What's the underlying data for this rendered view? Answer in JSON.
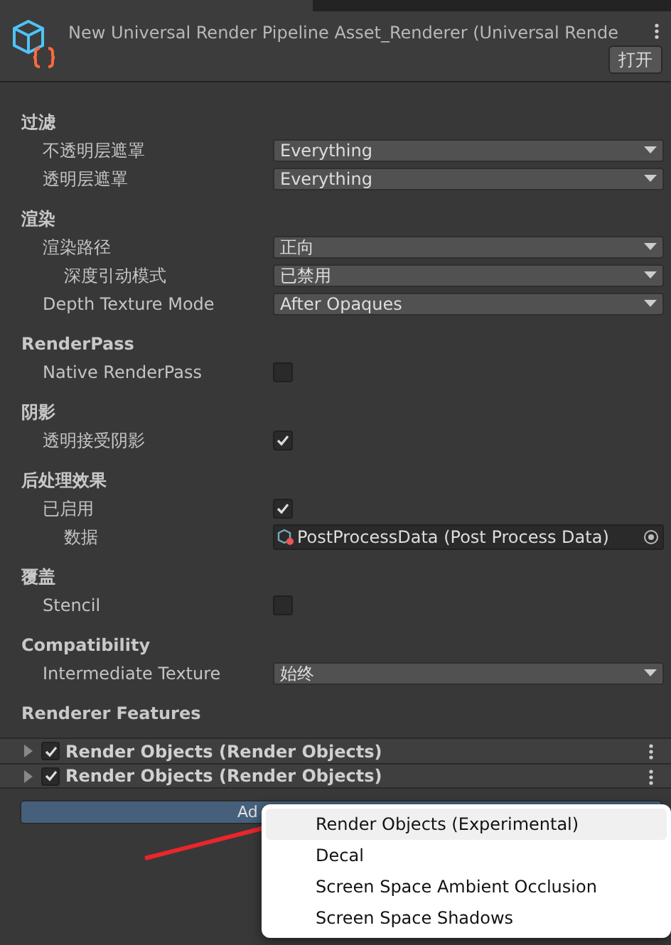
{
  "header": {
    "title": "New Universal Render Pipeline Asset_Renderer (Universal Rende",
    "open_button": "打开"
  },
  "sections": [
    {
      "title": "过滤",
      "rows": [
        {
          "label": "不透明层遮罩",
          "kind": "dropdown",
          "value": "Everything"
        },
        {
          "label": "透明层遮罩",
          "kind": "dropdown",
          "value": "Everything"
        }
      ]
    },
    {
      "title": "渲染",
      "rows": [
        {
          "label": "渲染路径",
          "kind": "dropdown",
          "value": "正向",
          "children": [
            {
              "label": "深度引动模式",
              "kind": "dropdown",
              "value": "已禁用"
            }
          ]
        },
        {
          "label": "Depth Texture Mode",
          "kind": "dropdown",
          "value": "After Opaques"
        }
      ]
    },
    {
      "title": "RenderPass",
      "rows": [
        {
          "label": "Native RenderPass",
          "kind": "checkbox",
          "checked": false
        }
      ]
    },
    {
      "title": "阴影",
      "rows": [
        {
          "label": "透明接受阴影",
          "kind": "checkbox",
          "checked": true
        }
      ]
    },
    {
      "title": "后处理效果",
      "rows": [
        {
          "label": "已启用",
          "kind": "checkbox",
          "checked": true,
          "children": [
            {
              "label": "数据",
              "kind": "object",
              "value": "PostProcessData (Post Process Data)"
            }
          ]
        }
      ]
    },
    {
      "title": "覆盖",
      "rows": [
        {
          "label": "Stencil",
          "kind": "checkbox",
          "checked": false
        }
      ]
    },
    {
      "title": "Compatibility",
      "rows": [
        {
          "label": "Intermediate Texture",
          "kind": "dropdown",
          "value": "始终"
        }
      ]
    }
  ],
  "renderer_features": {
    "title": "Renderer Features",
    "items": [
      {
        "label": "Render Objects (Render Objects)",
        "enabled": true,
        "expanded": false
      },
      {
        "label": "Render Objects (Render Objects)",
        "enabled": true,
        "expanded": false
      }
    ],
    "add_button": "Ad"
  },
  "popup_menu": [
    {
      "label": "Render Objects (Experimental)",
      "selected": true
    },
    {
      "label": "Decal",
      "selected": false
    },
    {
      "label": "Screen Space Ambient Occlusion",
      "selected": false
    },
    {
      "label": "Screen Space Shadows",
      "selected": false
    }
  ]
}
